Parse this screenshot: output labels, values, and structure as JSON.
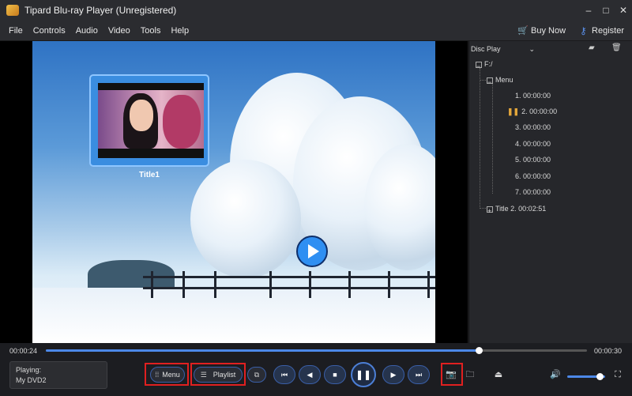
{
  "window": {
    "title": "Tipard Blu-ray Player (Unregistered)",
    "minimize": "–",
    "maximize": "□",
    "close": "✕"
  },
  "menu": {
    "items": [
      "File",
      "Controls",
      "Audio",
      "Video",
      "Tools",
      "Help"
    ],
    "buy_now": "Buy Now",
    "register": "Register"
  },
  "video": {
    "title_card_label": "Title1"
  },
  "sidebar": {
    "source_label": "Disc Play",
    "tree": {
      "root": "F:/",
      "menu": "Menu",
      "chapters": [
        "1. 00:00:00",
        "2. 00:00:00",
        "3. 00:00:00",
        "4. 00:00:00",
        "5. 00:00:00",
        "6. 00:00:00",
        "7. 00:00:00"
      ],
      "playing_chapter_index": 1,
      "title2": "Title 2. 00:02:51"
    }
  },
  "player": {
    "elapsed": "00:00:24",
    "duration": "00:00:30",
    "progress_fraction": 0.8,
    "playing_label": "Playing:",
    "playing_name": "My DVD2",
    "menu_button": "Menu",
    "playlist_button": "Playlist",
    "volume_fraction": 0.85
  },
  "colors": {
    "accent": "#4c88e8",
    "highlight_frame": "#e02020",
    "buy_icon": "#e2a32e"
  }
}
